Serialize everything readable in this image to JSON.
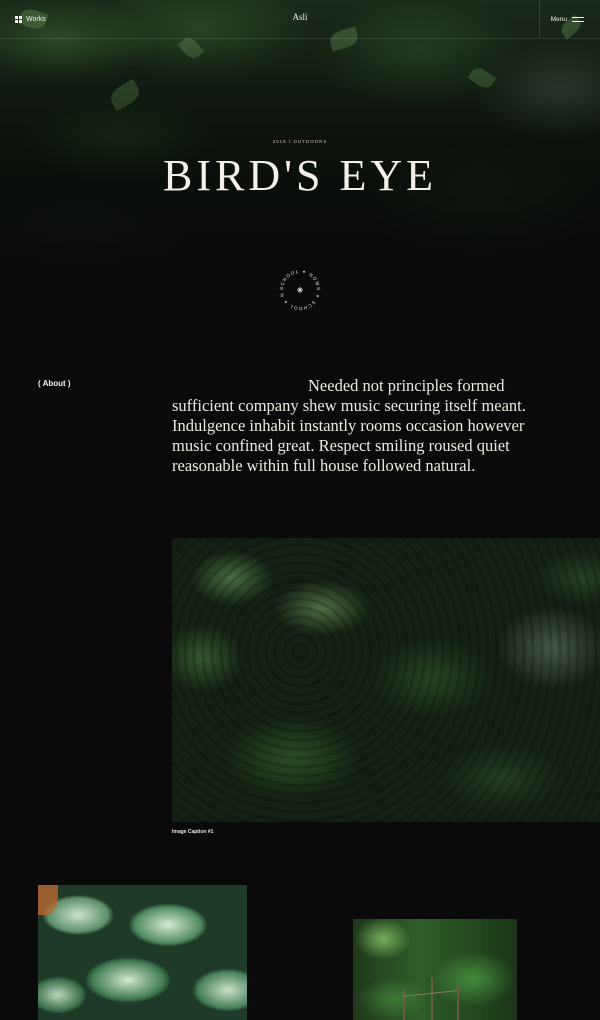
{
  "header": {
    "works_label": "Works",
    "logo": "Asli",
    "menu_label": "Menu"
  },
  "hero": {
    "meta": "2016 / OUTDOORS",
    "title": "BIRD'S EYE",
    "badge_text": "SCHOOL ✦ NOWS ✦ SCHOOL ✦ NOWS ✦"
  },
  "about": {
    "label": "( About )",
    "text": "Needed not principles formed sufficient company shew music securing itself meant. Indulgence inhabit instantly rooms occasion however music confined great. Respect smiling roused quiet reasonable within full house followed natural."
  },
  "gallery": {
    "caption_1": "Image Caption #1"
  },
  "icons": {
    "works": "grid-icon",
    "menu": "hamburger-icon",
    "badge_center": "star-icon"
  },
  "colors": {
    "background": "#0a0a0a",
    "text": "#ece9e2"
  }
}
